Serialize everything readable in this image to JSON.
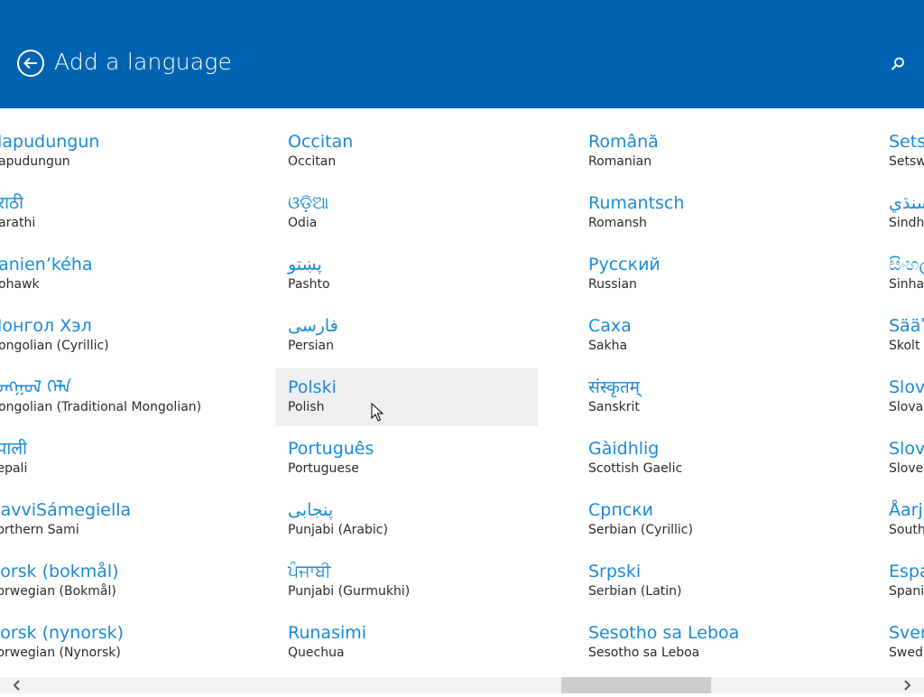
{
  "header": {
    "title": "Add a language",
    "accent_color": "#0063b1",
    "back_icon": "back-arrow-icon",
    "search_icon": "search-icon"
  },
  "columns": [
    {
      "items": [
        {
          "native": "Mapudungun",
          "english": "Mapudungun"
        },
        {
          "native": "मराठी",
          "english": "Marathi"
        },
        {
          "native": "Kanien’kéha",
          "english": "Mohawk"
        },
        {
          "native": "Монгол Хэл",
          "english": "Mongolian (Cyrillic)"
        },
        {
          "native": "ᠮᠣᠩᠭᠣᠯ ᠬᠡᠯᠡ",
          "english": "Mongolian (Traditional Mongolian)"
        },
        {
          "native": "नेपाली",
          "english": "Nepali"
        },
        {
          "native": "DavviSámegiella",
          "english": "Northern Sami"
        },
        {
          "native": "Norsk (bokmål)",
          "english": "Norwegian (Bokmål)"
        },
        {
          "native": "Norsk (nynorsk)",
          "english": "Norwegian (Nynorsk)"
        }
      ]
    },
    {
      "items": [
        {
          "native": "Occitan",
          "english": "Occitan"
        },
        {
          "native": "ଓଡ଼ିଆ",
          "english": "Odia"
        },
        {
          "native": "پښتو",
          "english": "Pashto"
        },
        {
          "native": "فارسی",
          "english": "Persian"
        },
        {
          "native": "Polski",
          "english": "Polish"
        },
        {
          "native": "Português",
          "english": "Portuguese"
        },
        {
          "native": "پنجابی",
          "english": "Punjabi (Arabic)"
        },
        {
          "native": "ਪੰਜਾਬੀ",
          "english": "Punjabi (Gurmukhi)"
        },
        {
          "native": "Runasimi",
          "english": "Quechua"
        }
      ]
    },
    {
      "items": [
        {
          "native": "Română",
          "english": "Romanian"
        },
        {
          "native": "Rumantsch",
          "english": "Romansh"
        },
        {
          "native": "Русский",
          "english": "Russian"
        },
        {
          "native": "Саха",
          "english": "Sakha"
        },
        {
          "native": "संस्कृतम्",
          "english": "Sanskrit"
        },
        {
          "native": "Gàidhlig",
          "english": "Scottish Gaelic"
        },
        {
          "native": "Српски",
          "english": "Serbian (Cyrillic)"
        },
        {
          "native": "Srpski",
          "english": "Serbian (Latin)"
        },
        {
          "native": "Sesotho sa Leboa",
          "english": "Sesotho sa Leboa"
        }
      ]
    },
    {
      "items": [
        {
          "native": "Setswana",
          "english": "Setswana"
        },
        {
          "native": "سنڌي",
          "english": "Sindhi"
        },
        {
          "native": "සිංහල",
          "english": "Sinhala"
        },
        {
          "native": "Sääʹmǩiõll",
          "english": "Skolt Sami"
        },
        {
          "native": "Slovenčina",
          "english": "Slovak"
        },
        {
          "native": "Slovenščina",
          "english": "Slovenian"
        },
        {
          "native": "Åarjelsaemien",
          "english": "Southern Sami"
        },
        {
          "native": "Español",
          "english": "Spanish"
        },
        {
          "native": "Svenska",
          "english": "Swedish"
        }
      ]
    }
  ],
  "hovered_item": "Polski",
  "scrollbar": {
    "left_icon": "chevron-left-icon",
    "right_icon": "chevron-right-icon"
  }
}
